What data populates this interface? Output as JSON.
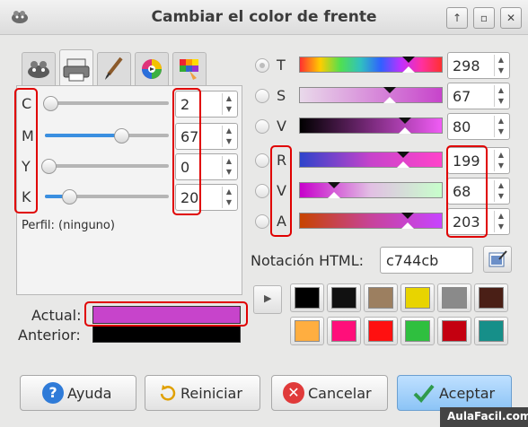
{
  "window": {
    "title": "Cambiar el color de frente",
    "controls": [
      "up-icon",
      "restore-icon",
      "close-icon"
    ]
  },
  "tabs": [
    {
      "icon": "gimp-wilber-icon"
    },
    {
      "icon": "printer-icon",
      "selected": true
    },
    {
      "icon": "paintbrush-icon"
    },
    {
      "icon": "color-wheel-icon"
    },
    {
      "icon": "palette-icon"
    }
  ],
  "cmyk": {
    "channels": [
      {
        "label": "C",
        "value": "2",
        "level": 0.02
      },
      {
        "label": "M",
        "value": "67",
        "level": 0.67
      },
      {
        "label": "Y",
        "value": "0",
        "level": 0.0
      },
      {
        "label": "K",
        "value": "20",
        "level": 0.2
      }
    ],
    "profile": "Perfil: (ninguno)"
  },
  "channels": [
    {
      "label": "T",
      "value": "298",
      "selected": true
    },
    {
      "label": "S",
      "value": "67"
    },
    {
      "label": "V",
      "value": "80"
    },
    {
      "label": "R",
      "value": "199"
    },
    {
      "label": "V",
      "value": "68"
    },
    {
      "label": "A",
      "value": "203"
    }
  ],
  "html": {
    "label": "Notación HTML:",
    "value": "c744cb"
  },
  "history": [
    "#000000",
    "#111111",
    "#9c7f60",
    "#e8d400",
    "#8a8a8a",
    "#4a1f16",
    "#ffae40",
    "#ff0f7a",
    "#ff1010",
    "#2fbf3f",
    "#c40010",
    "#168f89"
  ],
  "preview": {
    "current_label": "Actual:",
    "current_color": "#c744cb",
    "previous_label": "Anterior:",
    "previous_color": "#000000"
  },
  "buttons": {
    "help": "Ayuda",
    "reset": "Reiniciar",
    "cancel": "Cancelar",
    "ok": "Aceptar"
  },
  "watermark": "AulaFacil.com"
}
